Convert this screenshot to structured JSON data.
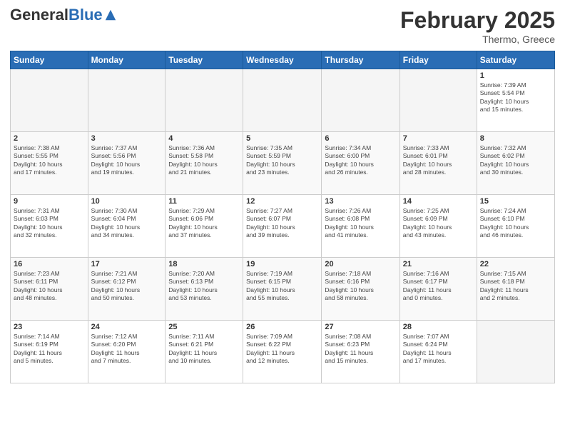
{
  "logo": {
    "general": "General",
    "blue": "Blue"
  },
  "header": {
    "title": "February 2025",
    "subtitle": "Thermo, Greece"
  },
  "days_of_week": [
    "Sunday",
    "Monday",
    "Tuesday",
    "Wednesday",
    "Thursday",
    "Friday",
    "Saturday"
  ],
  "weeks": [
    [
      {
        "day": "",
        "info": ""
      },
      {
        "day": "",
        "info": ""
      },
      {
        "day": "",
        "info": ""
      },
      {
        "day": "",
        "info": ""
      },
      {
        "day": "",
        "info": ""
      },
      {
        "day": "",
        "info": ""
      },
      {
        "day": "1",
        "info": "Sunrise: 7:39 AM\nSunset: 5:54 PM\nDaylight: 10 hours\nand 15 minutes."
      }
    ],
    [
      {
        "day": "2",
        "info": "Sunrise: 7:38 AM\nSunset: 5:55 PM\nDaylight: 10 hours\nand 17 minutes."
      },
      {
        "day": "3",
        "info": "Sunrise: 7:37 AM\nSunset: 5:56 PM\nDaylight: 10 hours\nand 19 minutes."
      },
      {
        "day": "4",
        "info": "Sunrise: 7:36 AM\nSunset: 5:58 PM\nDaylight: 10 hours\nand 21 minutes."
      },
      {
        "day": "5",
        "info": "Sunrise: 7:35 AM\nSunset: 5:59 PM\nDaylight: 10 hours\nand 23 minutes."
      },
      {
        "day": "6",
        "info": "Sunrise: 7:34 AM\nSunset: 6:00 PM\nDaylight: 10 hours\nand 26 minutes."
      },
      {
        "day": "7",
        "info": "Sunrise: 7:33 AM\nSunset: 6:01 PM\nDaylight: 10 hours\nand 28 minutes."
      },
      {
        "day": "8",
        "info": "Sunrise: 7:32 AM\nSunset: 6:02 PM\nDaylight: 10 hours\nand 30 minutes."
      }
    ],
    [
      {
        "day": "9",
        "info": "Sunrise: 7:31 AM\nSunset: 6:03 PM\nDaylight: 10 hours\nand 32 minutes."
      },
      {
        "day": "10",
        "info": "Sunrise: 7:30 AM\nSunset: 6:04 PM\nDaylight: 10 hours\nand 34 minutes."
      },
      {
        "day": "11",
        "info": "Sunrise: 7:29 AM\nSunset: 6:06 PM\nDaylight: 10 hours\nand 37 minutes."
      },
      {
        "day": "12",
        "info": "Sunrise: 7:27 AM\nSunset: 6:07 PM\nDaylight: 10 hours\nand 39 minutes."
      },
      {
        "day": "13",
        "info": "Sunrise: 7:26 AM\nSunset: 6:08 PM\nDaylight: 10 hours\nand 41 minutes."
      },
      {
        "day": "14",
        "info": "Sunrise: 7:25 AM\nSunset: 6:09 PM\nDaylight: 10 hours\nand 43 minutes."
      },
      {
        "day": "15",
        "info": "Sunrise: 7:24 AM\nSunset: 6:10 PM\nDaylight: 10 hours\nand 46 minutes."
      }
    ],
    [
      {
        "day": "16",
        "info": "Sunrise: 7:23 AM\nSunset: 6:11 PM\nDaylight: 10 hours\nand 48 minutes."
      },
      {
        "day": "17",
        "info": "Sunrise: 7:21 AM\nSunset: 6:12 PM\nDaylight: 10 hours\nand 50 minutes."
      },
      {
        "day": "18",
        "info": "Sunrise: 7:20 AM\nSunset: 6:13 PM\nDaylight: 10 hours\nand 53 minutes."
      },
      {
        "day": "19",
        "info": "Sunrise: 7:19 AM\nSunset: 6:15 PM\nDaylight: 10 hours\nand 55 minutes."
      },
      {
        "day": "20",
        "info": "Sunrise: 7:18 AM\nSunset: 6:16 PM\nDaylight: 10 hours\nand 58 minutes."
      },
      {
        "day": "21",
        "info": "Sunrise: 7:16 AM\nSunset: 6:17 PM\nDaylight: 11 hours\nand 0 minutes."
      },
      {
        "day": "22",
        "info": "Sunrise: 7:15 AM\nSunset: 6:18 PM\nDaylight: 11 hours\nand 2 minutes."
      }
    ],
    [
      {
        "day": "23",
        "info": "Sunrise: 7:14 AM\nSunset: 6:19 PM\nDaylight: 11 hours\nand 5 minutes."
      },
      {
        "day": "24",
        "info": "Sunrise: 7:12 AM\nSunset: 6:20 PM\nDaylight: 11 hours\nand 7 minutes."
      },
      {
        "day": "25",
        "info": "Sunrise: 7:11 AM\nSunset: 6:21 PM\nDaylight: 11 hours\nand 10 minutes."
      },
      {
        "day": "26",
        "info": "Sunrise: 7:09 AM\nSunset: 6:22 PM\nDaylight: 11 hours\nand 12 minutes."
      },
      {
        "day": "27",
        "info": "Sunrise: 7:08 AM\nSunset: 6:23 PM\nDaylight: 11 hours\nand 15 minutes."
      },
      {
        "day": "28",
        "info": "Sunrise: 7:07 AM\nSunset: 6:24 PM\nDaylight: 11 hours\nand 17 minutes."
      },
      {
        "day": "",
        "info": ""
      }
    ]
  ]
}
